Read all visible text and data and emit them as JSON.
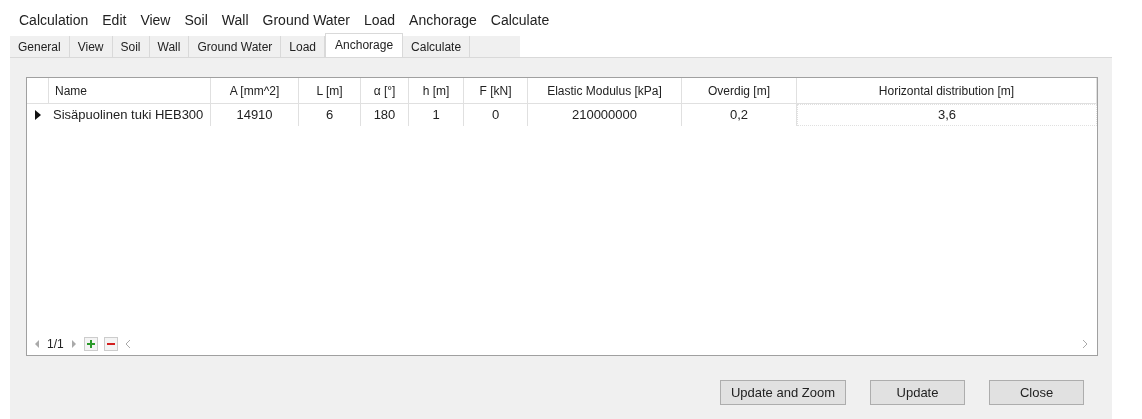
{
  "menu": [
    "Calculation",
    "Edit",
    "View",
    "Soil",
    "Wall",
    "Ground Water",
    "Load",
    "Anchorage",
    "Calculate"
  ],
  "tabs": [
    {
      "label": "General",
      "selected": false
    },
    {
      "label": "View",
      "selected": false
    },
    {
      "label": "Soil",
      "selected": false
    },
    {
      "label": "Wall",
      "selected": false
    },
    {
      "label": "Ground Water",
      "selected": false
    },
    {
      "label": "Load",
      "selected": false
    },
    {
      "label": "Anchorage",
      "selected": true
    },
    {
      "label": "Calculate",
      "selected": false
    }
  ],
  "table": {
    "columns": [
      "Name",
      "A [mm^2]",
      "L [m]",
      "α [°]",
      "h [m]",
      "F [kN]",
      "Elastic Modulus [kPa]",
      "Overdig [m]",
      "Horizontal distribution [m]"
    ],
    "rows": [
      {
        "selected": true,
        "cells": [
          "Sisäpuolinen tuki HEB300",
          "14910",
          "6",
          "180",
          "1",
          "0",
          "210000000",
          "0,2",
          "3,6"
        ]
      }
    ]
  },
  "navigator": {
    "position": "1/1"
  },
  "buttons": [
    "Update and Zoom",
    "Update",
    "Close"
  ]
}
